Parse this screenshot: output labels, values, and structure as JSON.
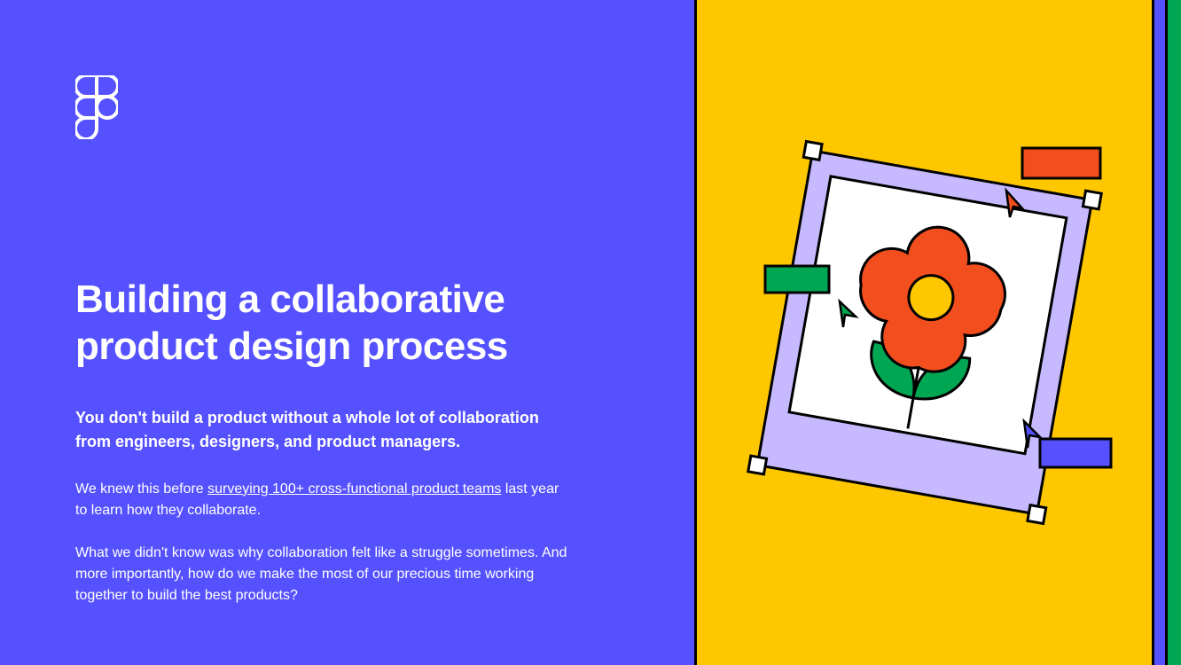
{
  "left": {
    "heading": "Building a collaborative product design process",
    "subheading": "You don't build a product without a whole lot of collaboration from engineers, designers, and product managers.",
    "body1_prefix": "We knew this before ",
    "body1_link": "surveying 100+ cross-functional product teams",
    "body1_suffix": " last year to learn how they collaborate.",
    "body2": "What we didn't know was why collaboration felt like a struggle sometimes. And more importantly, how do we make the most of our precious time working together to build the best products?"
  },
  "colors": {
    "purple": "#5551FF",
    "yellow": "#FFC700",
    "green": "#00A651",
    "orange": "#F24E1E",
    "lavender": "#C7B9FF",
    "white": "#FFFFFF",
    "black": "#000000",
    "blue": "#5551FF"
  }
}
